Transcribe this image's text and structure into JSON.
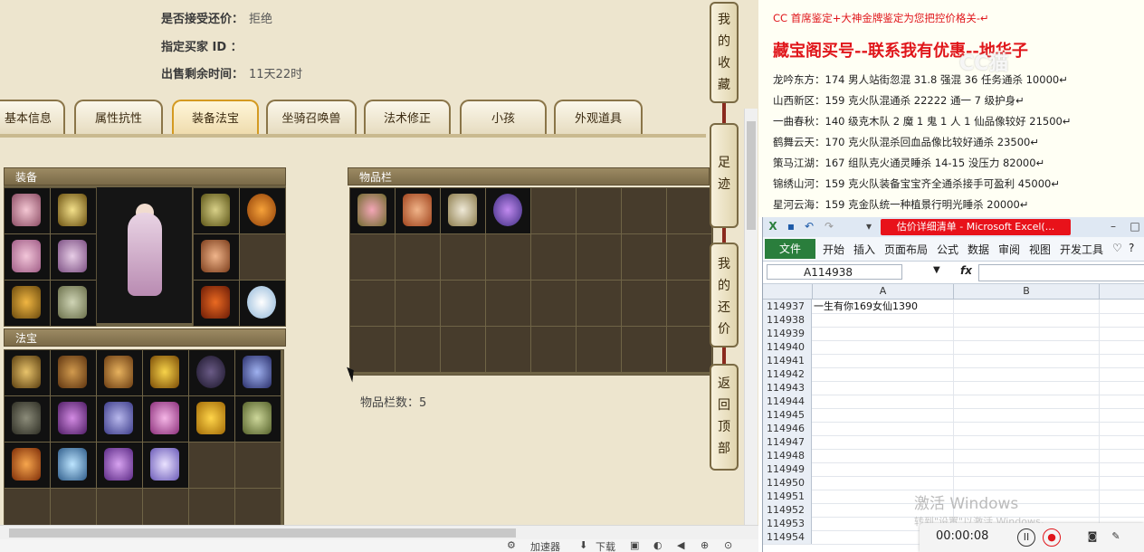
{
  "game": {
    "info": [
      {
        "label": "是否接受还价：",
        "value": "拒绝"
      },
      {
        "label": "指定买家 ID ：",
        "value": ""
      },
      {
        "label": "出售剩余时间：",
        "value": "11天22时"
      }
    ],
    "tabs": [
      "基本信息",
      "属性抗性",
      "装备法宝",
      "坐骑召唤兽",
      "法术修正",
      "小孩",
      "外观道具"
    ],
    "active_tab": "装备法宝",
    "panels": {
      "equipment": "装备",
      "treasure": "法宝",
      "inventory": "物品栏",
      "inventory_count": "物品栏数：5"
    },
    "side_buttons": [
      {
        "name": "favorites",
        "chars": [
          "我",
          "的",
          "收",
          "藏"
        ]
      },
      {
        "name": "footprints",
        "chars": [
          "足",
          "迹"
        ]
      },
      {
        "name": "my-offers",
        "chars": [
          "我",
          "的",
          "还",
          "价"
        ]
      },
      {
        "name": "back-to-top",
        "chars": [
          "返",
          "回",
          "顶",
          "部"
        ]
      }
    ],
    "status_bar": [
      "加速器",
      "下载"
    ]
  },
  "post": {
    "lines": [
      {
        "text": "CC 首席鉴定+大神金牌鉴定为您把控价格关-↵",
        "style": "red"
      },
      {
        "text": "藏宝阁买号--联系我有优惠--地华子",
        "style": "big"
      },
      {
        "text": "龙吟东方：174 男人站街忽混 31.8 强混 36 任务通杀 10000↵",
        "style": ""
      },
      {
        "text": "山西新区：159 克火队混通杀 22222 通一 7 级护身↵",
        "style": ""
      },
      {
        "text": "一曲春秋：140 级克木队 2 魔 1 鬼 1 人 1 仙品像较好 21500↵",
        "style": ""
      },
      {
        "text": "鹤舞云天：170 克火队混杀回血品像比较好通杀 23500↵",
        "style": ""
      },
      {
        "text": "策马江湖：167 组队克火通灵睡杀 14-15 没压力 82000↵",
        "style": ""
      },
      {
        "text": "锦绣山河：159 克火队装备宝宝齐全通杀接手可盈利 45000↵",
        "style": ""
      },
      {
        "text": "星河云海：159 克金队统一种植景行明光睡杀 20000↵",
        "style": ""
      }
    ],
    "logo": "CC猫"
  },
  "excel": {
    "caption": "估价详细清单 - Microsoft Excel(...",
    "file_tab": "文件",
    "ribbon_tabs": [
      "开始",
      "插入",
      "页面布局",
      "公式",
      "数据",
      "审阅",
      "视图",
      "开发工具"
    ],
    "namebox": "A114938",
    "fx": "fx",
    "columns": [
      "A",
      "B"
    ],
    "rows": [
      {
        "n": "114937",
        "a": "一生有你169女仙1390"
      },
      {
        "n": "114938",
        "a": ""
      },
      {
        "n": "114939",
        "a": ""
      },
      {
        "n": "114940",
        "a": ""
      },
      {
        "n": "114941",
        "a": ""
      },
      {
        "n": "114942",
        "a": ""
      },
      {
        "n": "114943",
        "a": ""
      },
      {
        "n": "114944",
        "a": ""
      },
      {
        "n": "114945",
        "a": ""
      },
      {
        "n": "114946",
        "a": ""
      },
      {
        "n": "114947",
        "a": ""
      },
      {
        "n": "114948",
        "a": ""
      },
      {
        "n": "114949",
        "a": ""
      },
      {
        "n": "114950",
        "a": ""
      },
      {
        "n": "114951",
        "a": ""
      },
      {
        "n": "114952",
        "a": ""
      },
      {
        "n": "114953",
        "a": ""
      },
      {
        "n": "114954",
        "a": ""
      }
    ]
  },
  "windows_watermark": {
    "line1": "激活 Windows",
    "line2": "转到\"设置\"以激活 Windows。"
  },
  "recorder": {
    "time": "00:00:08"
  },
  "colors": {
    "accent_red": "#e0161b",
    "excel_green": "#2a7e3c",
    "panel_brown": "#473c2c"
  }
}
